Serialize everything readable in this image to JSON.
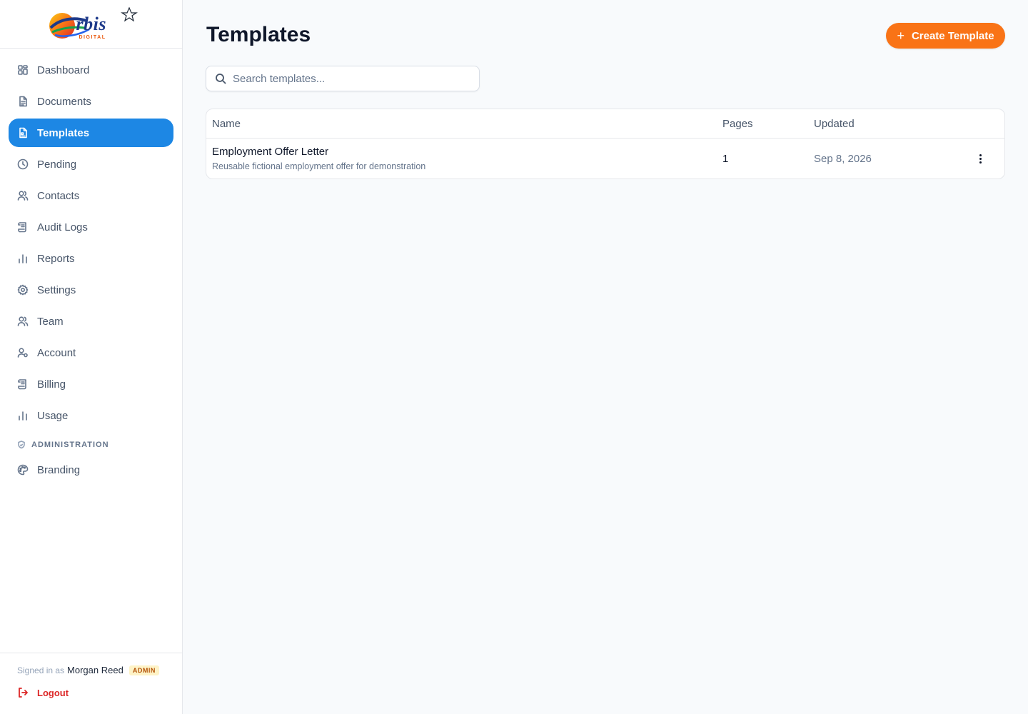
{
  "brand": {
    "name": "rbis",
    "sub": "DIGITAL"
  },
  "sidebar": {
    "items": [
      {
        "label": "Dashboard",
        "icon": "dashboard-icon"
      },
      {
        "label": "Documents",
        "icon": "document-icon"
      },
      {
        "label": "Templates",
        "icon": "template-icon",
        "active": true
      },
      {
        "label": "Pending",
        "icon": "clock-icon"
      },
      {
        "label": "Contacts",
        "icon": "users-icon"
      },
      {
        "label": "Audit Logs",
        "icon": "scroll-icon"
      },
      {
        "label": "Reports",
        "icon": "bar-chart-icon"
      },
      {
        "label": "Settings",
        "icon": "gear-icon"
      },
      {
        "label": "Team",
        "icon": "users-icon"
      },
      {
        "label": "Account",
        "icon": "user-cog-icon"
      },
      {
        "label": "Billing",
        "icon": "scroll-icon"
      },
      {
        "label": "Usage",
        "icon": "bar-chart-icon"
      }
    ],
    "section_label": "ADMINISTRATION",
    "admin_items": [
      {
        "label": "Branding",
        "icon": "palette-icon"
      }
    ],
    "footer": {
      "signed_in_prefix": "Signed in as",
      "user_name": "Morgan Reed",
      "role_badge": "ADMIN",
      "logout_label": "Logout"
    }
  },
  "main": {
    "title": "Templates",
    "create_button": "Create Template",
    "search_placeholder": "Search templates...",
    "table": {
      "columns": [
        "Name",
        "Pages",
        "Updated"
      ],
      "rows": [
        {
          "name": "Employment Offer Letter",
          "description": "Reusable fictional employment offer for demonstration",
          "pages": "1",
          "updated": "Sep 8, 2026"
        }
      ]
    }
  },
  "colors": {
    "active_nav": "#1d87e4",
    "accent": "#f97316",
    "danger": "#dc2626",
    "badge_bg": "#fef3c7"
  }
}
